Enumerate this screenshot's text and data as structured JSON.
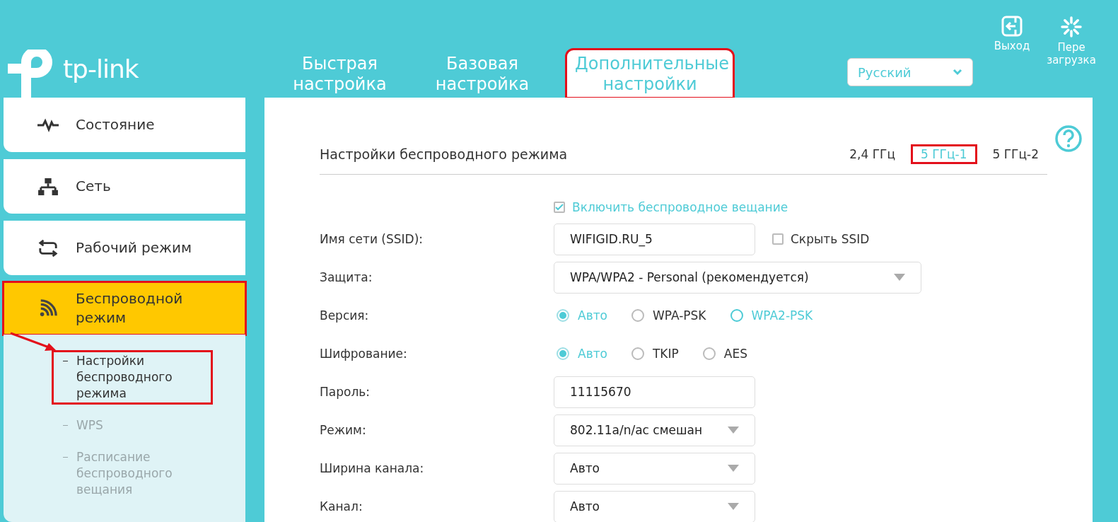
{
  "logo": {
    "text": "tp-link"
  },
  "top_tabs": [
    {
      "label": "Быстрая настройка",
      "selected": false,
      "annotated": false
    },
    {
      "label": "Базовая настройка",
      "selected": false,
      "annotated": false
    },
    {
      "label": "Дополнительные настройки",
      "selected": true,
      "annotated": true
    }
  ],
  "language": {
    "value": "Русский"
  },
  "actions": [
    {
      "kind": "logout",
      "label": "Выход"
    },
    {
      "kind": "reboot",
      "label": "Пере загрузка"
    }
  ],
  "sidebar": {
    "items": [
      {
        "kind": "status",
        "label": "Состояние",
        "selected": false,
        "annotated": false
      },
      {
        "kind": "network",
        "label": "Сеть",
        "selected": false,
        "annotated": false
      },
      {
        "kind": "mode",
        "label": "Рабочий режим",
        "selected": false,
        "annotated": false
      },
      {
        "kind": "wireless",
        "label": "Беспроводной режим",
        "selected": true,
        "annotated": true,
        "children": [
          {
            "label": "Настройки беспроводного режима",
            "selected": true,
            "annotated": true
          },
          {
            "label": "WPS",
            "selected": false,
            "annotated": false
          },
          {
            "label": "Расписание беспроводного вещания",
            "selected": false,
            "annotated": false
          }
        ]
      }
    ]
  },
  "panel": {
    "title": "Настройки беспроводного режима",
    "bands": [
      {
        "label": "2,4 ГГц",
        "selected": false,
        "annotated": false
      },
      {
        "label": "5 ГГц-1",
        "selected": true,
        "annotated": true
      },
      {
        "label": "5 ГГц-2",
        "selected": false,
        "annotated": false
      }
    ],
    "enable": {
      "label": "Включить беспроводное вещание",
      "checked": true
    },
    "rows": [
      {
        "kind": "text",
        "label": "Имя сети (SSID):",
        "value": "WIFIGID.RU_5",
        "checkbox": {
          "label": "Скрыть SSID",
          "checked": false
        }
      },
      {
        "kind": "select",
        "label": "Защита:",
        "value": "WPA/WPA2 - Personal (рекомендуется)",
        "wide": true
      },
      {
        "kind": "radio",
        "label": "Версия:",
        "options": [
          {
            "label": "Авто",
            "selected": true,
            "hover": false
          },
          {
            "label": "WPA-PSK",
            "selected": false,
            "hover": false
          },
          {
            "label": "WPA2-PSK",
            "selected": false,
            "hover": true
          }
        ]
      },
      {
        "kind": "radio",
        "label": "Шифрование:",
        "options": [
          {
            "label": "Авто",
            "selected": true,
            "hover": false
          },
          {
            "label": "TKIP",
            "selected": false,
            "hover": false
          },
          {
            "label": "AES",
            "selected": false,
            "hover": false
          }
        ]
      },
      {
        "kind": "text",
        "label": "Пароль:",
        "value": "11115670"
      },
      {
        "kind": "select",
        "label": "Режим:",
        "value": "802.11a/n/ac смешан",
        "wide": false
      },
      {
        "kind": "select",
        "label": "Ширина канала:",
        "value": "Авто",
        "wide": false
      },
      {
        "kind": "select",
        "label": "Канал:",
        "value": "Авто",
        "wide": false
      }
    ]
  }
}
